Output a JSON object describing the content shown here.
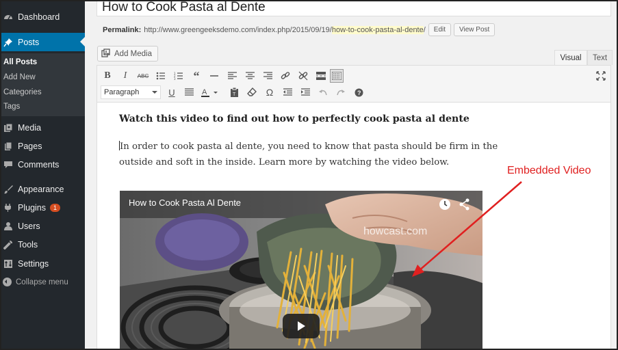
{
  "sidebar": {
    "dashboard": "Dashboard",
    "posts": "Posts",
    "posts_submenu": [
      "All Posts",
      "Add New",
      "Categories",
      "Tags"
    ],
    "media": "Media",
    "pages": "Pages",
    "comments": "Comments",
    "appearance": "Appearance",
    "plugins": "Plugins",
    "plugins_badge": "1",
    "users": "Users",
    "tools": "Tools",
    "settings": "Settings",
    "collapse": "Collapse menu"
  },
  "post": {
    "title": "How to Cook Pasta al Dente",
    "permalink_label": "Permalink:",
    "permalink_base": "http://www.greengeeksdemo.com/index.php/2015/09/19/",
    "permalink_slug": "how-to-cook-pasta-al-dente",
    "permalink_trail": "/",
    "edit_button": "Edit",
    "view_button": "View Post"
  },
  "editor": {
    "add_media": "Add Media",
    "tab_visual": "Visual",
    "tab_text": "Text",
    "format_select": "Paragraph",
    "heading": "Watch this video to find out how to perfectly cook pasta al dente",
    "paragraph": "In order to cook pasta al dente, you need to know that pasta should be firm in the outside and soft in the inside. Learn more by watching the video below."
  },
  "video": {
    "title": "How to Cook Pasta Al Dente",
    "watermark": "howcast.com"
  },
  "annotation": {
    "label": "Embedded Video",
    "color": "#e02020"
  },
  "colors": {
    "sidebar_bg": "#23282d",
    "active_bg": "#0073aa",
    "badge": "#d54e21"
  }
}
